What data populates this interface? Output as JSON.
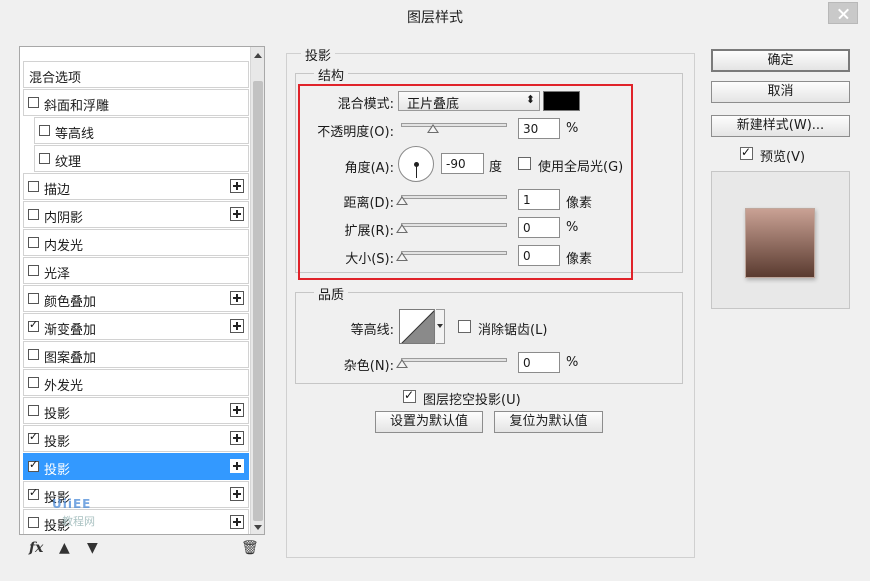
{
  "dialog": {
    "title": "图层样式"
  },
  "style_list": {
    "header": "混合选项",
    "items": [
      {
        "label": "斜面和浮雕",
        "checked": false,
        "plus": false,
        "sub": false
      },
      {
        "label": "等高线",
        "checked": false,
        "plus": false,
        "sub": true
      },
      {
        "label": "纹理",
        "checked": false,
        "plus": false,
        "sub": true
      },
      {
        "label": "描边",
        "checked": false,
        "plus": true,
        "sub": false
      },
      {
        "label": "内阴影",
        "checked": false,
        "plus": true,
        "sub": false
      },
      {
        "label": "内发光",
        "checked": false,
        "plus": false,
        "sub": false
      },
      {
        "label": "光泽",
        "checked": false,
        "plus": false,
        "sub": false
      },
      {
        "label": "颜色叠加",
        "checked": false,
        "plus": true,
        "sub": false
      },
      {
        "label": "渐变叠加",
        "checked": true,
        "plus": true,
        "sub": false
      },
      {
        "label": "图案叠加",
        "checked": false,
        "plus": false,
        "sub": false
      },
      {
        "label": "外发光",
        "checked": false,
        "plus": false,
        "sub": false
      },
      {
        "label": "投影",
        "checked": false,
        "plus": true,
        "sub": false
      },
      {
        "label": "投影",
        "checked": true,
        "plus": true,
        "sub": false
      },
      {
        "label": "投影",
        "checked": true,
        "plus": true,
        "sub": false,
        "selected": true
      },
      {
        "label": "投影",
        "checked": true,
        "plus": true,
        "sub": false
      },
      {
        "label": "投影",
        "checked": false,
        "plus": true,
        "sub": false
      }
    ],
    "toolbar": {
      "fx": "fx",
      "up": "▲",
      "down": "▼",
      "trash": "🗑"
    },
    "watermark": "UiiEE",
    "watermark_sub": "教程网"
  },
  "shadow": {
    "section_title": "投影",
    "structure": {
      "title": "结构",
      "blend_mode_label": "混合模式:",
      "blend_mode_value": "正片叠底",
      "shadow_color": "#000000",
      "opacity_label": "不透明度(O):",
      "opacity_value": "30",
      "opacity_unit": "%",
      "opacity_level": 0.3,
      "angle_label": "角度(A):",
      "angle_value": "-90",
      "angle_unit": "度",
      "global_light_label": "使用全局光(G)",
      "global_light_checked": false,
      "distance_label": "距离(D):",
      "distance_value": "1",
      "distance_unit": "像素",
      "spread_label": "扩展(R):",
      "spread_value": "0",
      "spread_unit": "%",
      "size_label": "大小(S):",
      "size_value": "0",
      "size_unit": "像素"
    },
    "quality": {
      "title": "品质",
      "contour_label": "等高线:",
      "anti_alias_label": "消除锯齿(L)",
      "anti_alias_checked": false,
      "noise_label": "杂色(N):",
      "noise_value": "0",
      "noise_unit": "%"
    },
    "knockout_label": "图层挖空投影(U)",
    "knockout_checked": true,
    "set_default_label": "设置为默认值",
    "reset_default_label": "复位为默认值"
  },
  "actions": {
    "ok_label": "确定",
    "cancel_label": "取消",
    "new_style_label": "新建样式(W)...",
    "preview_label": "预览(V)",
    "preview_checked": true
  },
  "colors": {
    "selection": "#3399ff",
    "highlight_border": "#e0232a",
    "preview_gradient_top": "#c9a194",
    "preview_gradient_bottom": "#5a3b30"
  }
}
